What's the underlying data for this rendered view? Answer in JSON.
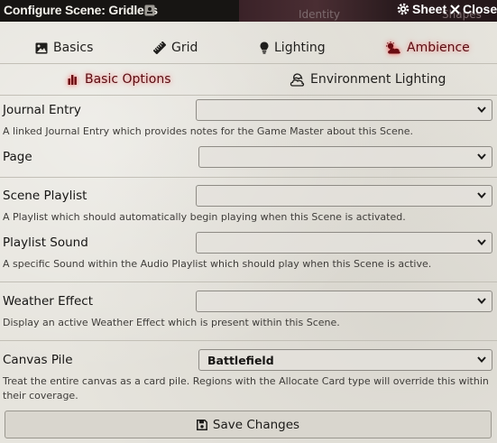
{
  "window": {
    "title": "Configure Scene: Gridless",
    "header_buttons": {
      "sheet": "Sheet",
      "close": "Close"
    },
    "background_tabs": {
      "identity": "Identity",
      "shapes": "Shapes"
    }
  },
  "tabs": [
    {
      "label": "Basics",
      "icon": "image-icon",
      "active": false
    },
    {
      "label": "Grid",
      "icon": "ruler-icon",
      "active": false
    },
    {
      "label": "Lighting",
      "icon": "lightbulb-icon",
      "active": false
    },
    {
      "label": "Ambience",
      "icon": "cloud-sun-icon",
      "active": true
    }
  ],
  "subtabs": [
    {
      "label": "Basic Options",
      "icon": "bars-icon",
      "active": true
    },
    {
      "label": "Environment Lighting",
      "icon": "cloud-moon-icon",
      "active": false
    }
  ],
  "fields": {
    "journal_entry": {
      "label": "Journal Entry",
      "value": "",
      "hint": "A linked Journal Entry which provides notes for the Game Master about this Scene."
    },
    "page": {
      "label": "Page",
      "value": ""
    },
    "scene_playlist": {
      "label": "Scene Playlist",
      "value": "",
      "hint": "A Playlist which should automatically begin playing when this Scene is activated."
    },
    "playlist_sound": {
      "label": "Playlist Sound",
      "value": "",
      "hint": "A specific Sound within the Audio Playlist which should play when this Scene is active."
    },
    "weather_effect": {
      "label": "Weather Effect",
      "value": "",
      "hint": "Display an active Weather Effect which is present within this Scene."
    },
    "canvas_pile": {
      "label": "Canvas Pile",
      "value": "Battlefield",
      "hint": "Treat the entire canvas as a card pile. Regions with the Allocate Card type will override this within their coverage."
    }
  },
  "footer": {
    "save_label": "Save Changes"
  },
  "colors": {
    "accent": "#5a0a10",
    "glow": "#ff5a5a",
    "titlebar": "#171513"
  }
}
